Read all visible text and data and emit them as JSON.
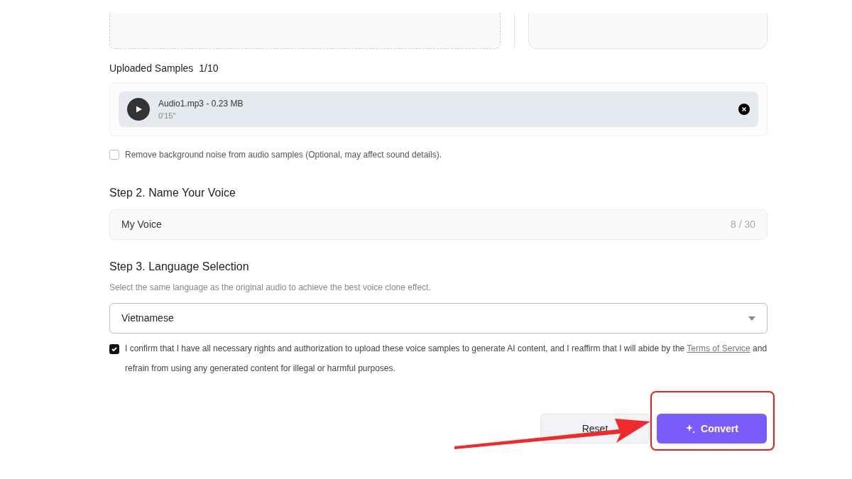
{
  "samples": {
    "title": "Uploaded Samples",
    "count": "1/10",
    "items": [
      {
        "name": "Audio1.mp3 - 0.23 MB",
        "duration": "0'15''"
      }
    ]
  },
  "noise_option": {
    "label": "Remove background noise from audio samples (Optional, may affect sound details).",
    "checked": false
  },
  "step2": {
    "title": "Step 2. Name Your Voice",
    "value": "My Voice",
    "counter": "8 / 30"
  },
  "step3": {
    "title": "Step 3. Language Selection",
    "hint": "Select the same language as the original audio to achieve the best voice clone effect.",
    "value": "Vietnamese"
  },
  "consent": {
    "checked": true,
    "text_before": "I confirm that I have all necessary rights and authorization to upload these voice samples to generate AI content, and I reaffirm that I will abide by the",
    "link": "Terms of Service",
    "text_after": "and refrain from using any generated content for illegal or harmful purposes."
  },
  "buttons": {
    "reset": "Reset",
    "convert": "Convert"
  }
}
